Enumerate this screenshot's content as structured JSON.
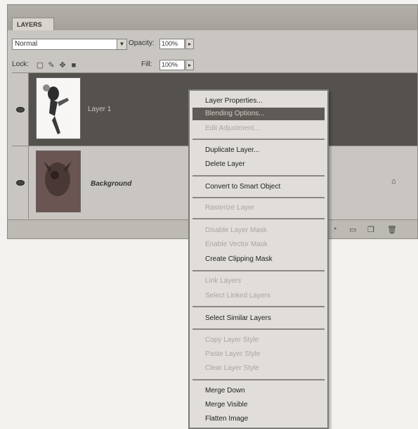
{
  "panel": {
    "tab_label": "LAYERS",
    "blend_mode": "Normal",
    "opacity_label": "Opacity:",
    "opacity_value": "100%",
    "lock_label": "Lock:",
    "fill_label": "Fill:",
    "fill_value": "100%"
  },
  "layers": [
    {
      "name": "Layer 1",
      "selected": true,
      "visible": true
    },
    {
      "name": "Background",
      "selected": false,
      "visible": true,
      "locked": true
    }
  ],
  "context_menu": {
    "items": [
      {
        "label": "Layer Properties...",
        "enabled": true
      },
      {
        "label": "Blending Options...",
        "enabled": true,
        "highlighted": true
      },
      {
        "label": "Edit Adjustment...",
        "enabled": false
      },
      {
        "label": "Duplicate Layer...",
        "enabled": true
      },
      {
        "label": "Delete Layer",
        "enabled": true
      },
      {
        "label": "Convert to Smart Object",
        "enabled": true
      },
      {
        "label": "Rasterize Layer",
        "enabled": false
      },
      {
        "label": "Disable Layer Mask",
        "enabled": false
      },
      {
        "label": "Enable Vector Mask",
        "enabled": false
      },
      {
        "label": "Create Clipping Mask",
        "enabled": true
      },
      {
        "label": "Link Layers",
        "enabled": false
      },
      {
        "label": "Select Linked Layers",
        "enabled": false
      },
      {
        "label": "Select Similar Layers",
        "enabled": true
      },
      {
        "label": "Copy Layer Style",
        "enabled": false
      },
      {
        "label": "Paste Layer Style",
        "enabled": false
      },
      {
        "label": "Clear Layer Style",
        "enabled": false
      },
      {
        "label": "Merge Down",
        "enabled": true
      },
      {
        "label": "Merge Visible",
        "enabled": true
      },
      {
        "label": "Flatten Image",
        "enabled": true
      }
    ]
  }
}
